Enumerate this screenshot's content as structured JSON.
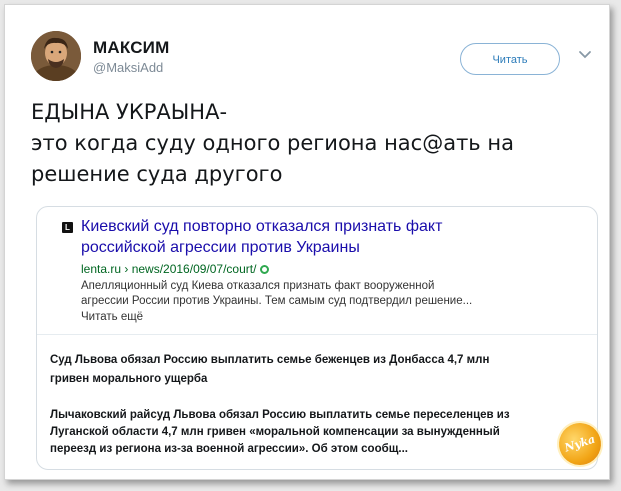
{
  "user": {
    "name": "МАКСИМ",
    "handle": "@MaksiAdd"
  },
  "actions": {
    "follow_label": "Читать"
  },
  "tweet": {
    "lines": [
      "ЕДЫНА УКРАЫНА-",
      "это когда суду одного региона нас@ать на",
      "решение суда другого"
    ]
  },
  "embed": {
    "source_icon": "L",
    "title_line1": "Киевский суд повторно отказался признать факт",
    "title_line2": "российской агрессии против Украины",
    "url": "lenta.ru › news/2016/09/07/court/",
    "desc_line1": "Апелляционный суд Киева отказался признать факт вооруженной",
    "desc_line2": "агрессии России против Украины. Тем самым суд подтвердил решение...",
    "more": "Читать ещё",
    "news1_line1": "Суд Львова обязал Россию выплатить семье беженцев из Донбасса 4,7 млн",
    "news1_line2": "гривен морального ущерба",
    "news2_line1": "Лычаковский райсуд Львова обязал Россию выплатить семье переселенцев из",
    "news2_line2": "Луганской области 4,7 млн гривен «моральной компенсации за вынужденный",
    "news2_line3": "переезд из региона из-за военной агрессии». Об этом сообщ..."
  },
  "watermark": {
    "text": "Nyka"
  },
  "colors": {
    "link": "#1a0dab",
    "url": "#006621",
    "follow": "#2b7bb9",
    "watermark": "#f2a516"
  },
  "icons": [
    "chevron-down-icon",
    "verified-dot-icon",
    "source-favicon-icon"
  ]
}
